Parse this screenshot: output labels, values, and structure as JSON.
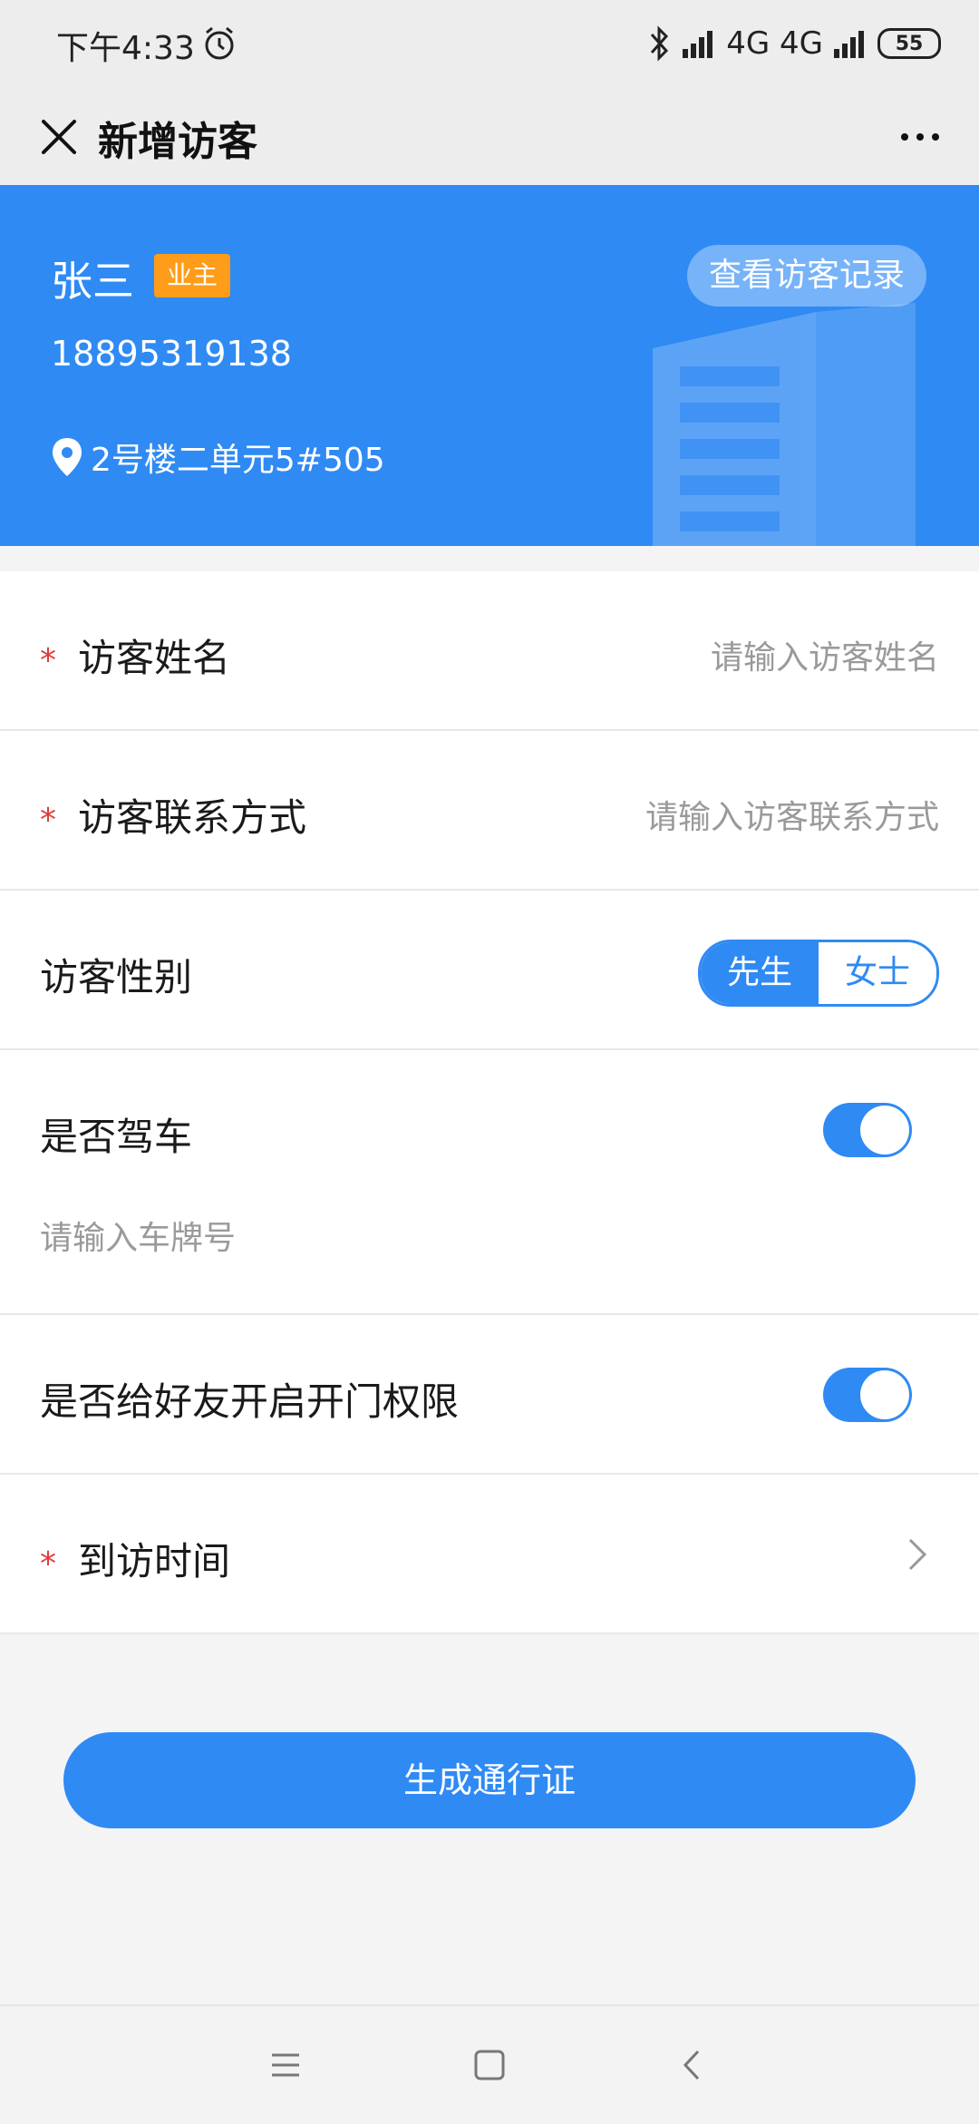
{
  "status_bar": {
    "time": "下午4:33",
    "network": "4G  4G",
    "battery": "55"
  },
  "nav": {
    "title": "新增访客"
  },
  "owner": {
    "name": "张三",
    "role_badge": "业主",
    "view_records_label": "查看访客记录",
    "phone": "18895319138",
    "address": "2号楼二单元5#505"
  },
  "form": {
    "required_mark": "*",
    "visitor_name": {
      "label": "访客姓名",
      "placeholder": "请输入访客姓名"
    },
    "visitor_contact": {
      "label": "访客联系方式",
      "placeholder": "请输入访客联系方式"
    },
    "visitor_gender": {
      "label": "访客性别",
      "options": [
        "先生",
        "女士"
      ],
      "selected": "先生"
    },
    "driving": {
      "label": "是否驾车",
      "enabled": true,
      "plate_placeholder": "请输入车牌号"
    },
    "door_permission": {
      "label": "是否给好友开启开门权限",
      "enabled": true
    },
    "visit_time": {
      "label": "到访时间"
    }
  },
  "submit_label": "生成通行证",
  "colors": {
    "primary": "#2f8af4",
    "badge": "#ff9c1a",
    "required": "#e43a3a"
  }
}
